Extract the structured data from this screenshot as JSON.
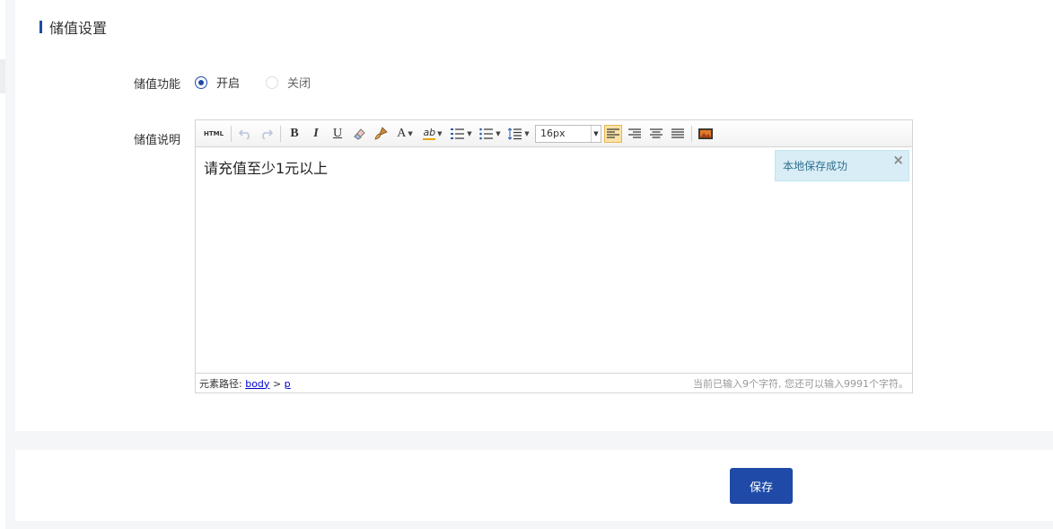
{
  "section": {
    "title": "储值设置"
  },
  "form": {
    "recharge_label": "储值功能",
    "options": [
      {
        "label": "开启",
        "checked": true
      },
      {
        "label": "关闭",
        "checked": false
      }
    ],
    "description_label": "储值说明"
  },
  "editor": {
    "toolbar": {
      "html_label": "HTML",
      "bold": "B",
      "italic": "I",
      "underline": "U",
      "font_color": "A",
      "highlight": "ab",
      "font_size": "16px"
    },
    "content": "请充值至少1元以上",
    "notice": "本地保存成功",
    "notice_close": "×",
    "path_label": "元素路径:",
    "path_body": "body",
    "path_sep": ">",
    "path_p": "p",
    "char_count": "当前已输入9个字符, 您还可以输入9991个字符。"
  },
  "footer": {
    "save_label": "保存"
  },
  "colors": {
    "accent": "#1f4aa8",
    "notice_bg": "#d9edf7"
  }
}
